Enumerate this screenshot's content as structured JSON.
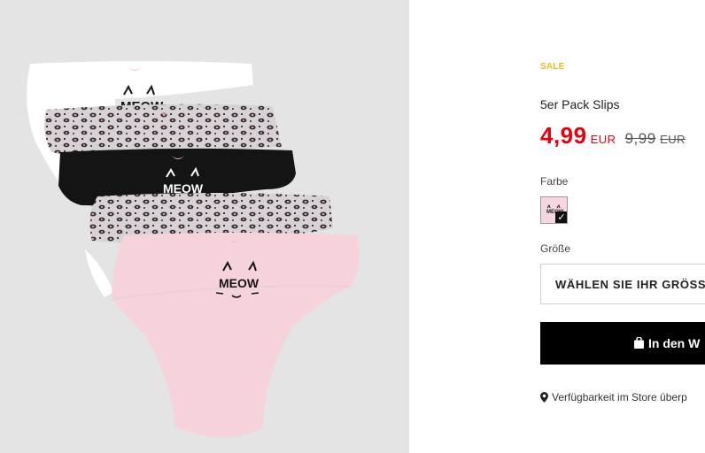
{
  "gallery": {
    "print_text": "MEOW",
    "colors": {
      "background": "#e4e4e4",
      "white": "#ffffff",
      "black": "#141414",
      "pink": "#f6d3da",
      "leopard": "#c8c8c8"
    }
  },
  "product": {
    "badge": "SALE",
    "name": "5er Pack Slips",
    "price": "4,99",
    "currency": "EUR",
    "old_price": "9,99",
    "old_currency": "EUR",
    "colors": {
      "sale": "#f0b722",
      "price": "#e3000f"
    }
  },
  "color_selector": {
    "label": "Farbe",
    "swatch_text": "MEOW",
    "check_icon": "check-icon"
  },
  "size_selector": {
    "label": "Größe",
    "placeholder": "WÄHLEN SIE IHR GRÖSS"
  },
  "cart": {
    "label": "In den W",
    "icon": "shopping-bag-icon"
  },
  "store": {
    "label": "Verfügbarkeit im Store überp",
    "icon": "map-pin-icon"
  }
}
